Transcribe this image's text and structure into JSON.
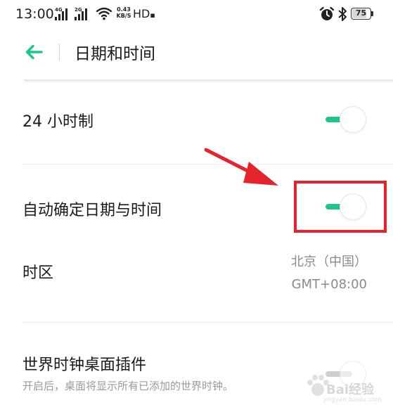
{
  "status_bar": {
    "time": "13:00",
    "signal_1_label": "4G",
    "signal_2_label": "2G",
    "net_speed_value": "0.43",
    "net_speed_unit": "KB/S",
    "hd_label": "HD",
    "battery_level": "75",
    "icons": [
      "signal-icon",
      "signal-icon",
      "wifi-icon",
      "alarm-icon",
      "bluetooth-icon",
      "battery-icon"
    ]
  },
  "header": {
    "title": "日期和时间",
    "back_icon": "back-arrow-icon"
  },
  "settings": {
    "hour24": {
      "label": "24 小时制",
      "enabled": true
    },
    "auto_datetime": {
      "label": "自动确定日期与时间",
      "enabled": true
    },
    "timezone": {
      "label": "时区",
      "city": "北京（中国）",
      "offset": "GMT+08:00"
    },
    "world_clock": {
      "label": "世界时钟桌面插件",
      "description": "开启后，桌面将显示所有已添加的世界时钟。"
    }
  },
  "watermark": {
    "text": "Bai经验",
    "sub": "jingyan.baidu.com"
  },
  "colors": {
    "accent": "#20c58a",
    "annotation": "#e5232d"
  }
}
